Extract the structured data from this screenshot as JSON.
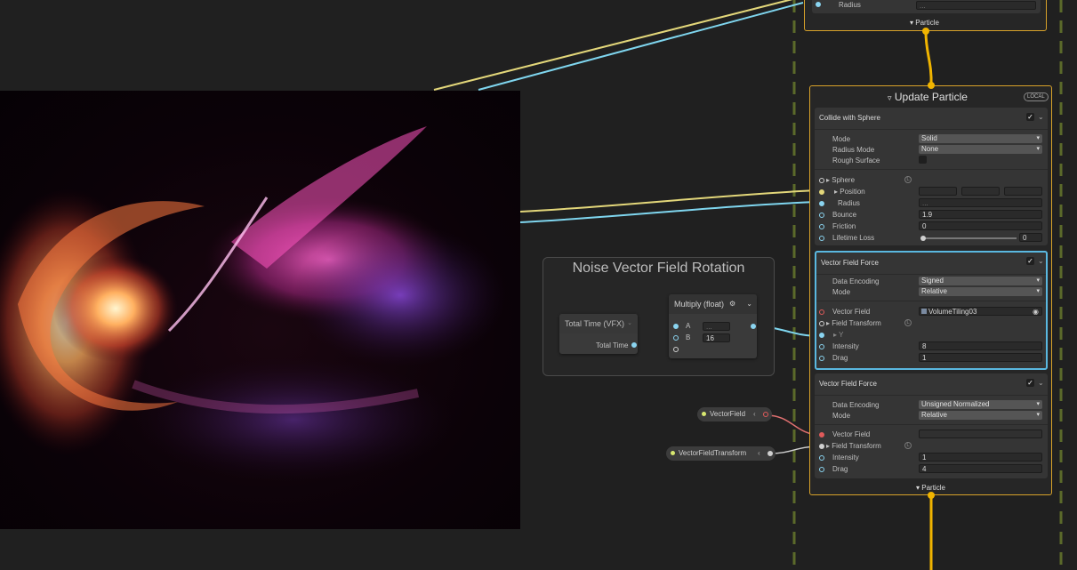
{
  "top_block": {
    "radius_label": "Radius",
    "radius_value": "...",
    "flow_label": "Particle"
  },
  "update": {
    "title": "Update Particle",
    "space_badge": "LOCAL",
    "collide": {
      "title": "Collide with Sphere",
      "mode_label": "Mode",
      "mode_value": "Solid",
      "radius_mode_label": "Radius Mode",
      "radius_mode_value": "None",
      "rough_label": "Rough Surface",
      "sphere_label": "Sphere",
      "position_label": "Position",
      "radius_label": "Radius",
      "radius_value": "...",
      "bounce_label": "Bounce",
      "bounce_value": "1.9",
      "friction_label": "Friction",
      "friction_value": "0",
      "lifetime_label": "Lifetime Loss",
      "lifetime_value": "0",
      "lifetime_level": 0
    },
    "vff1": {
      "title": "Vector Field Force",
      "encoding_label": "Data Encoding",
      "encoding_value": "Signed",
      "mode_label": "Mode",
      "mode_value": "Relative",
      "vf_label": "Vector Field",
      "vf_value": "VolumeTiling03",
      "transform_label": "Field Transform",
      "y_label": "Y",
      "intensity_label": "Intensity",
      "intensity_value": "8",
      "drag_label": "Drag",
      "drag_value": "1"
    },
    "vff2": {
      "title": "Vector Field Force",
      "encoding_label": "Data Encoding",
      "encoding_value": "Unsigned Normalized",
      "mode_label": "Mode",
      "mode_value": "Relative",
      "vf_label": "Vector Field",
      "transform_label": "Field Transform",
      "intensity_label": "Intensity",
      "intensity_value": "1",
      "drag_label": "Drag",
      "drag_value": "4"
    },
    "flow_label": "Particle"
  },
  "group": {
    "title": "Noise Vector Field Rotation",
    "total_time": {
      "title": "Total Time (VFX)",
      "output": "Total Time"
    },
    "multiply": {
      "title": "Multiply (float)",
      "a_label": "A",
      "a_value": "...",
      "b_label": "B",
      "b_value": "16"
    }
  },
  "properties": {
    "vector_field": "VectorField",
    "vector_field_transform": "VectorFieldTransform"
  },
  "colors": {
    "context_border": "#d8a22a",
    "selected_block_border": "#5ab8e0",
    "flow_wire": "#f0b400",
    "wire_yellow": "#e3d77a",
    "wire_cyan": "#7fd6ef",
    "wire_red": "#e07070",
    "guide_dash": "#5b6a2a"
  }
}
